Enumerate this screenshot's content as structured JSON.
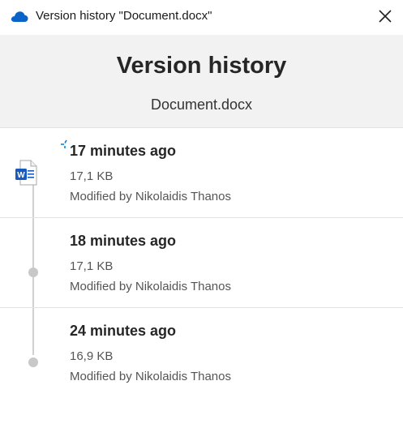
{
  "window": {
    "title": "Version history \"Document.docx\"",
    "icon": "onedrive-cloud-icon",
    "close_icon": "close-icon"
  },
  "header": {
    "title": "Version history",
    "file_name": "Document.docx"
  },
  "versions": [
    {
      "time": "17 minutes ago",
      "size": "17,1 KB",
      "modified_by": "Modified by Nikolaidis Thanos",
      "icon": "word-document-icon"
    },
    {
      "time": "18 minutes ago",
      "size": "17,1 KB",
      "modified_by": "Modified by Nikolaidis Thanos"
    },
    {
      "time": "24 minutes ago",
      "size": "16,9 KB",
      "modified_by": "Modified by Nikolaidis Thanos"
    }
  ],
  "colors": {
    "accent": "#0078d4",
    "word_blue": "#185abd",
    "header_bg": "#f2f2f2",
    "timeline": "#d0d0d0"
  }
}
